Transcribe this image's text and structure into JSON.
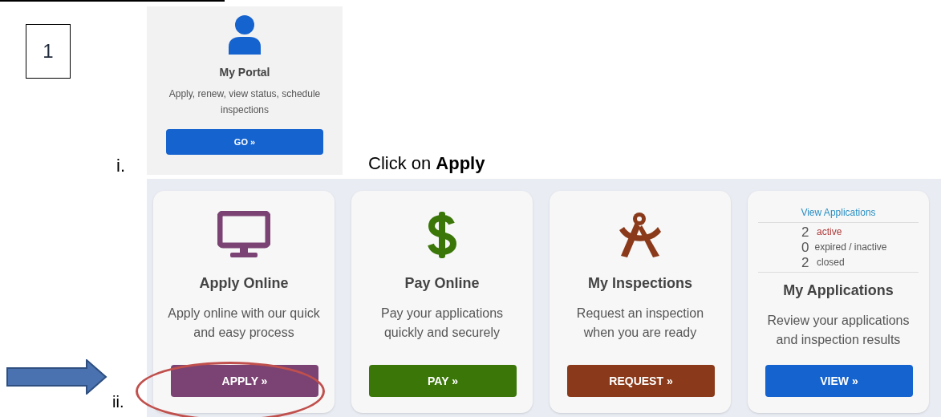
{
  "step_number": "1",
  "portal": {
    "title": "My Portal",
    "description": "Apply, renew, view status, schedule inspections",
    "button": "GO »"
  },
  "instructions": [
    {
      "marker": "i.",
      "text": "Click on **Apply**"
    },
    {
      "marker": "ii."
    }
  ],
  "cards": [
    {
      "kind": "icon",
      "title": "Apply Online",
      "description": "Apply online with our quick and easy process",
      "button": "APPLY »",
      "color": "#7b4373",
      "highlighted": true
    },
    {
      "kind": "icon",
      "title": "Pay Online",
      "description": "Pay your applications quickly and securely",
      "button": "PAY »",
      "color": "#3b7609",
      "highlighted": false
    },
    {
      "kind": "icon",
      "title": "My Inspections",
      "description": "Request an inspection when you are ready",
      "button": "REQUEST »",
      "color": "#8a3a1a",
      "highlighted": false
    },
    {
      "kind": "stats",
      "link": "View Applications",
      "stats": [
        {
          "count": "2",
          "label": "active",
          "color": "#b03a3a"
        },
        {
          "count": "0",
          "label": "expired / inactive",
          "color": "#555555"
        },
        {
          "count": "2",
          "label": "closed",
          "color": "#555555"
        }
      ],
      "title": "My Applications",
      "description": "Review your applications and inspection results",
      "button": "VIEW »",
      "color": "#1563cf",
      "highlighted": false
    }
  ]
}
